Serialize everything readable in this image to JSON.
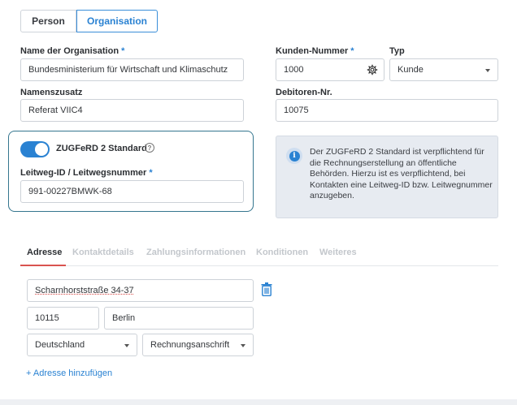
{
  "segment": {
    "person": "Person",
    "organisation": "Organisation"
  },
  "org_name": {
    "label": "Name der Organisation",
    "required": "*",
    "value": "Bundesministerium für Wirtschaft und Klimaschutz"
  },
  "customer_number": {
    "label": "Kunden-Nummer",
    "required": "*",
    "value": "1000"
  },
  "type": {
    "label": "Typ",
    "value": "Kunde"
  },
  "name_suffix": {
    "label": "Namenszusatz",
    "value": "Referat VIIC4"
  },
  "debtor_number": {
    "label": "Debitoren-Nr.",
    "value": "10075"
  },
  "zugferd": {
    "label": "ZUGFeRD 2 Standard",
    "help": "?",
    "enabled": true
  },
  "leitweg": {
    "label": "Leitweg-ID / Leitwegsnummer",
    "required": "*",
    "value": "991-00227BMWK-68"
  },
  "info": {
    "icon": "i",
    "text": "Der ZUGFeRD 2 Standard ist verpflichtend für die Rechnungserstellung an öffentliche Behörden. Hierzu ist es verpflichtend, bei Kontakten eine Leitweg-ID bzw. Leitwegnummer anzugeben."
  },
  "tabs": [
    "Adresse",
    "Kontaktdetails",
    "Zahlungsinformationen",
    "Konditionen",
    "Weiteres"
  ],
  "address": {
    "street": "Scharnhorststraße 34-37",
    "zip": "10115",
    "city": "Berlin",
    "country": "Deutschland",
    "address_type": "Rechnungsanschrift",
    "add_link": "+ Adresse hinzufügen"
  },
  "colors": {
    "accent": "#2a82d2",
    "active_tab_underline": "#d9534f",
    "zugferd_border": "#35768f"
  }
}
